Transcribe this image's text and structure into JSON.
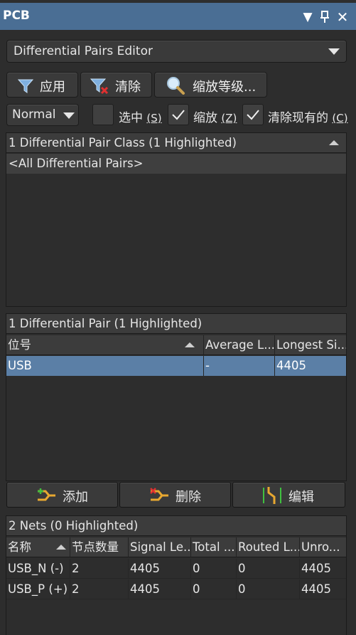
{
  "window": {
    "title": "PCB"
  },
  "panel_select": {
    "value": "Differential Pairs Editor"
  },
  "toolbar": {
    "apply_label": "应用",
    "clear_label": "清除",
    "zoom_level_label": "缩放等级..."
  },
  "filter": {
    "mode": "Normal",
    "select_label": "选中",
    "select_key": "(S)",
    "select_checked": false,
    "zoom_label": "缩放",
    "zoom_key": "(Z)",
    "zoom_checked": true,
    "clear_existing_label": "清除现有的",
    "clear_existing_key": "(C)",
    "clear_existing_checked": true
  },
  "classes_panel": {
    "header": "1 Differential Pair Class (1 Highlighted)",
    "items": [
      "<All Differential Pairs>"
    ]
  },
  "pairs_panel": {
    "header": "1 Differential Pair (1 Highlighted)",
    "columns": [
      "位号",
      "Average L...",
      "Longest Si..."
    ],
    "rows": [
      {
        "designator": "USB",
        "average": "-",
        "longest": "4405"
      }
    ]
  },
  "pair_actions": {
    "add_label": "添加",
    "delete_label": "删除",
    "edit_label": "编辑"
  },
  "nets_panel": {
    "header": "2 Nets (0 Highlighted)",
    "columns": [
      "名称",
      "节点数量",
      "Signal Le...",
      "Total ...",
      "Routed L...",
      "Unro..."
    ],
    "rows": [
      {
        "name": "USB_N (-)",
        "nodes": "2",
        "signal": "4405",
        "total": "0",
        "routed": "0",
        "unrouted": "4405"
      },
      {
        "name": "USB_P (+)",
        "nodes": "2",
        "signal": "4405",
        "total": "0",
        "routed": "0",
        "unrouted": "4405"
      }
    ]
  },
  "colors": {
    "titlebar": "#4a6e94",
    "highlight_row": "#5b7fa6",
    "background": "#2d2d2d"
  }
}
